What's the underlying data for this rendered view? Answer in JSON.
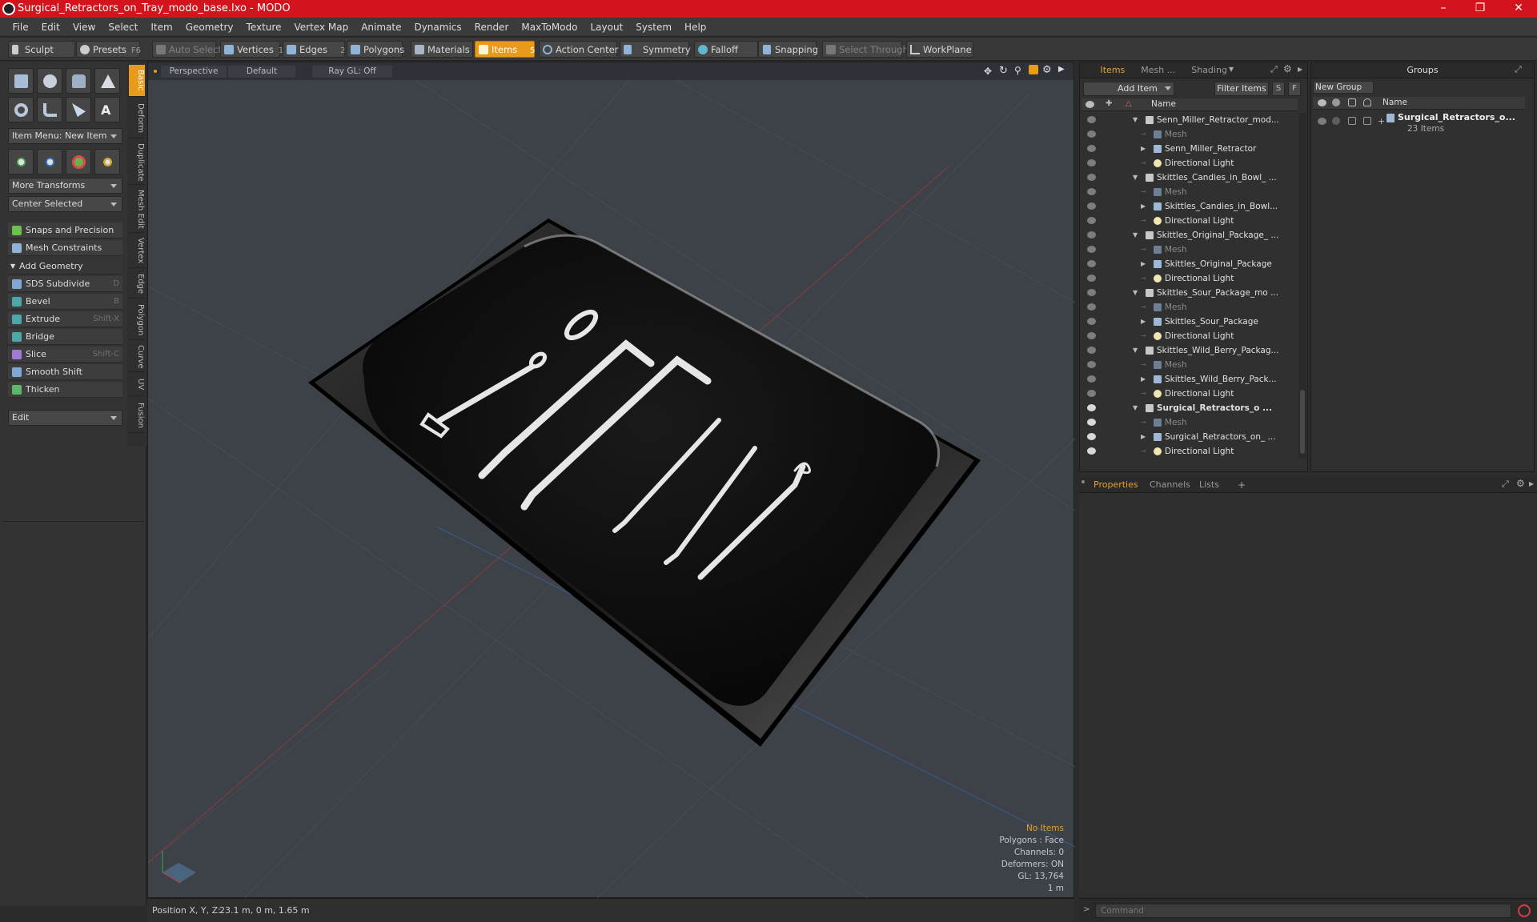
{
  "window": {
    "title": "Surgical_Retractors_on_Tray_modo_base.lxo - MODO"
  },
  "menu": [
    "File",
    "Edit",
    "View",
    "Select",
    "Item",
    "Geometry",
    "Texture",
    "Vertex Map",
    "Animate",
    "Dynamics",
    "Render",
    "MaxToModo",
    "Layout",
    "System",
    "Help"
  ],
  "toolbar": {
    "sculpt": "Sculpt",
    "presets": "Presets",
    "presets_key": "F6",
    "auto_select": "Auto Select",
    "vertices": "Vertices",
    "vertices_num": "1",
    "edges": "Edges",
    "edges_num": "2",
    "polygons": "Polygons",
    "materials": "Materials",
    "items": "Items",
    "items_num": "5",
    "action_center": "Action Center",
    "symmetry": "Symmetry",
    "falloff": "Falloff",
    "snapping": "Snapping",
    "select_through": "Select Through",
    "workplane": "WorkPlane"
  },
  "left": {
    "item_menu": "Item Menu: New Item",
    "more_transforms": "More Transforms",
    "center_selected": "Center Selected",
    "snaps": "Snaps and Precision",
    "mesh_constraints": "Mesh Constraints",
    "add_geometry": "Add Geometry",
    "tools": [
      {
        "label": "SDS Subdivide",
        "key": "D"
      },
      {
        "label": "Bevel",
        "key": "B"
      },
      {
        "label": "Extrude",
        "key": "Shift-X"
      },
      {
        "label": "Bridge",
        "key": ""
      },
      {
        "label": "Slice",
        "key": "Shift-C"
      },
      {
        "label": "Smooth Shift",
        "key": ""
      },
      {
        "label": "Thicken",
        "key": ""
      }
    ],
    "edit": "Edit",
    "side_tabs": [
      "Basic",
      "Deform",
      "Duplicate",
      "Mesh Edit",
      "Vertex",
      "Edge",
      "Polygon",
      "Curve",
      "UV",
      "Fusion"
    ]
  },
  "viewport": {
    "view": "Perspective",
    "shading": "Default",
    "raygl": "Ray GL: Off",
    "info": [
      "No Items",
      "Polygons : Face",
      "Channels: 0",
      "Deformers: ON",
      "GL: 13,764",
      "1 m"
    ],
    "position_label": "Position X, Y, Z:",
    "position_value": "23.1 m, 0 m, 1.65 m"
  },
  "items_panel": {
    "tabs": [
      "Items",
      "Mesh ...",
      "Shading"
    ],
    "add_item": "Add Item",
    "filter_items": "Filter Items",
    "s_btn": "S",
    "f_btn": "F",
    "name_header": "Name",
    "rows": [
      {
        "label": "Senn_Miller_Retractor_mod...",
        "type": "scene",
        "indent": 0,
        "eye": "dim"
      },
      {
        "label": "Mesh",
        "type": "mesh",
        "indent": 2,
        "eye": "dim"
      },
      {
        "label": "Senn_Miller_Retractor",
        "type": "group",
        "indent": 1,
        "eye": "dim"
      },
      {
        "label": "Directional Light",
        "type": "light",
        "indent": 1,
        "eye": "dim"
      },
      {
        "label": "Skittles_Candies_in_Bowl_ ...",
        "type": "scene",
        "indent": 0,
        "eye": "dim"
      },
      {
        "label": "Mesh",
        "type": "mesh",
        "indent": 2,
        "eye": "dim"
      },
      {
        "label": "Skittles_Candies_in_Bowl...",
        "type": "group",
        "indent": 1,
        "eye": "dim"
      },
      {
        "label": "Directional Light",
        "type": "light",
        "indent": 1,
        "eye": "dim"
      },
      {
        "label": "Skittles_Original_Package_ ...",
        "type": "scene",
        "indent": 0,
        "eye": "dim"
      },
      {
        "label": "Mesh",
        "type": "mesh",
        "indent": 2,
        "eye": "dim"
      },
      {
        "label": "Skittles_Original_Package",
        "type": "group",
        "indent": 1,
        "eye": "dim"
      },
      {
        "label": "Directional Light",
        "type": "light",
        "indent": 1,
        "eye": "dim"
      },
      {
        "label": "Skittles_Sour_Package_mo ...",
        "type": "scene",
        "indent": 0,
        "eye": "dim"
      },
      {
        "label": "Mesh",
        "type": "mesh",
        "indent": 2,
        "eye": "dim"
      },
      {
        "label": "Skittles_Sour_Package",
        "type": "group",
        "indent": 1,
        "eye": "dim"
      },
      {
        "label": "Directional Light",
        "type": "light",
        "indent": 1,
        "eye": "dim"
      },
      {
        "label": "Skittles_Wild_Berry_Packag...",
        "type": "scene",
        "indent": 0,
        "eye": "dim"
      },
      {
        "label": "Mesh",
        "type": "mesh",
        "indent": 2,
        "eye": "dim"
      },
      {
        "label": "Skittles_Wild_Berry_Pack...",
        "type": "group",
        "indent": 1,
        "eye": "dim"
      },
      {
        "label": "Directional Light",
        "type": "light",
        "indent": 1,
        "eye": "dim"
      },
      {
        "label": "Surgical_Retractors_o ...",
        "type": "scene",
        "indent": 0,
        "eye": "bright",
        "bold": true
      },
      {
        "label": "Mesh",
        "type": "mesh",
        "indent": 2,
        "eye": "bright"
      },
      {
        "label": "Surgical_Retractors_on_ ...",
        "type": "group",
        "indent": 1,
        "eye": "bright"
      },
      {
        "label": "Directional Light",
        "type": "light",
        "indent": 1,
        "eye": "bright"
      }
    ]
  },
  "groups_panel": {
    "title": "Groups",
    "new_group": "New Group",
    "name_header": "Name",
    "group_name": "Surgical_Retractors_o...",
    "group_count": "23 Items"
  },
  "bottom_panel": {
    "tabs": [
      "Properties",
      "Channels",
      "Lists"
    ],
    "add": "+"
  },
  "command": {
    "placeholder": "Command"
  }
}
